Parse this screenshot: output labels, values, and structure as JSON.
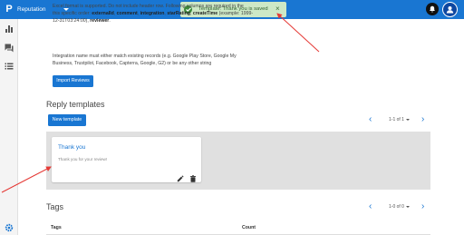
{
  "header": {
    "logo_letter": "P",
    "app_name": "Reputation"
  },
  "toast": {
    "message": "Template: Thank you is saved",
    "close": "×"
  },
  "import": {
    "line1": "Excel format is supported. Do not include header row. Following columns are required in the",
    "line2_pre": "this specific order: ",
    "col1": "externalId",
    "col2": "comment",
    "col3": "integration",
    "col4": "starRating",
    "col5": "createTime",
    "example": " (example: 1999-",
    "line3": "12-31T03:24:00), ",
    "col6": "reviewer",
    "line3_end": ".",
    "note1": "Integration name must either match existing records (e.g. Google Play Store, Google My",
    "note2": "Business, Trustpilot, Facebook, Capterra, Google, G2) or be any other string",
    "button": "Import Reviews"
  },
  "reply_templates": {
    "title": "Reply templates",
    "new_button": "New template",
    "pager": "1-1 of 1",
    "cards": [
      {
        "title": "Thank you",
        "body": "Thank you for your review!"
      }
    ]
  },
  "tags": {
    "title": "Tags",
    "pager": "1-0 of 0",
    "columns": [
      "Tags",
      "Count"
    ]
  },
  "colors": {
    "primary": "#1976d2",
    "toast_bg": "#cde8c6",
    "toast_icon": "#3c8a3c",
    "annotation_arrow": "#e53935"
  },
  "icons": [
    "bar-chart-icon",
    "reviews-icon",
    "list-icon",
    "settings-icon",
    "bell-icon",
    "user-icon",
    "check-circle-icon",
    "edit-icon",
    "delete-icon",
    "chevron-left-icon",
    "chevron-right-icon"
  ]
}
